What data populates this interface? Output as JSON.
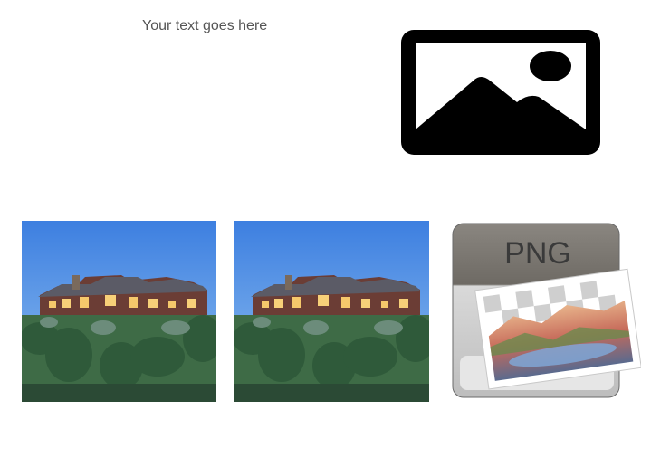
{
  "text_box": {
    "text": "Your text goes here"
  },
  "placeholder_icon": "image-icon",
  "photos": [
    {
      "icon": "house-photo"
    },
    {
      "icon": "house-photo"
    }
  ],
  "file_icon": {
    "label": "PNG",
    "icon": "png-file-icon"
  },
  "colors": {
    "text": "#555555",
    "sky": "#4a8fe0",
    "foliage": "#3e6b46",
    "icon_black": "#000000"
  }
}
